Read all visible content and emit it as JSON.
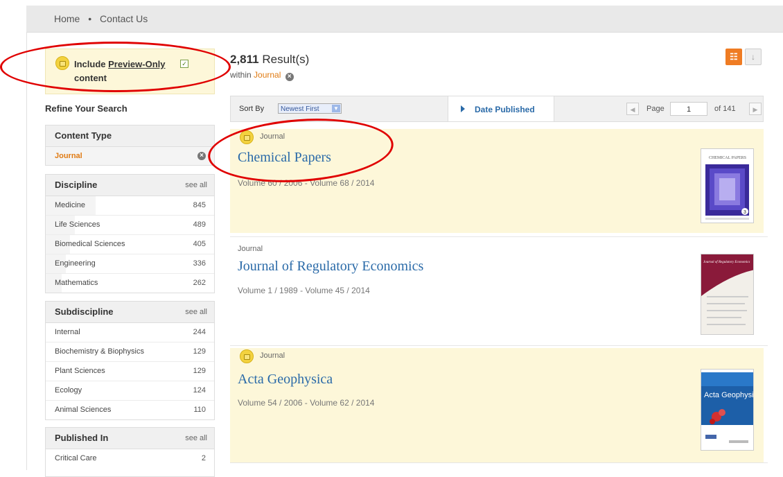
{
  "nav": {
    "home": "Home",
    "sep": "•",
    "contact": "Contact Us"
  },
  "preview": {
    "line1_prefix": "Include ",
    "line1_link": "Preview-Only",
    "line2": "content",
    "checked": "✓"
  },
  "refine": "Refine Your Search",
  "content_type": {
    "title": "Content Type",
    "selected": "Journal"
  },
  "discipline": {
    "title": "Discipline",
    "see_all": "see all",
    "items": [
      {
        "name": "Medicine",
        "count": "845"
      },
      {
        "name": "Life Sciences",
        "count": "489"
      },
      {
        "name": "Biomedical Sciences",
        "count": "405"
      },
      {
        "name": "Engineering",
        "count": "336"
      },
      {
        "name": "Mathematics",
        "count": "262"
      }
    ]
  },
  "subdiscipline": {
    "title": "Subdiscipline",
    "see_all": "see all",
    "items": [
      {
        "name": "Internal",
        "count": "244"
      },
      {
        "name": "Biochemistry & Biophysics",
        "count": "129"
      },
      {
        "name": "Plant Sciences",
        "count": "129"
      },
      {
        "name": "Ecology",
        "count": "124"
      },
      {
        "name": "Animal Sciences",
        "count": "110"
      }
    ]
  },
  "published_in": {
    "title": "Published In",
    "see_all": "see all",
    "items": [
      {
        "name": "Critical Care",
        "count": "2"
      }
    ]
  },
  "results": {
    "count": "2,811",
    "label": " Result(s)",
    "within": "within ",
    "within_value": "Journal"
  },
  "sort": {
    "label": "Sort By",
    "value": "Newest First",
    "date_published": "Date Published"
  },
  "pager": {
    "page_label": "Page",
    "page": "1",
    "of": "of 141"
  },
  "items": [
    {
      "type": "Journal",
      "title": "Chemical Papers",
      "volumes": "Volume 60 / 2006 - Volume 68 / 2014",
      "preview_only": true
    },
    {
      "type": "Journal",
      "title": "Journal of Regulatory Economics",
      "volumes": "Volume 1 / 1989 - Volume 45 / 2014",
      "preview_only": false
    },
    {
      "type": "Journal",
      "title": "Acta Geophysica",
      "volumes": "Volume 54 / 2006 - Volume 62 / 2014",
      "preview_only": true
    }
  ],
  "covers": {
    "chem_title": "CHEMICAL PAPERS",
    "chem_issue": "3",
    "jre_title": "Journal of Regulatory Economics",
    "acta_title": "Acta Geophysica"
  },
  "colors": {
    "accent": "#2a6aa8",
    "highlight": "#fdf7d9",
    "orange": "#e07b13",
    "annotation": "#e00000"
  }
}
